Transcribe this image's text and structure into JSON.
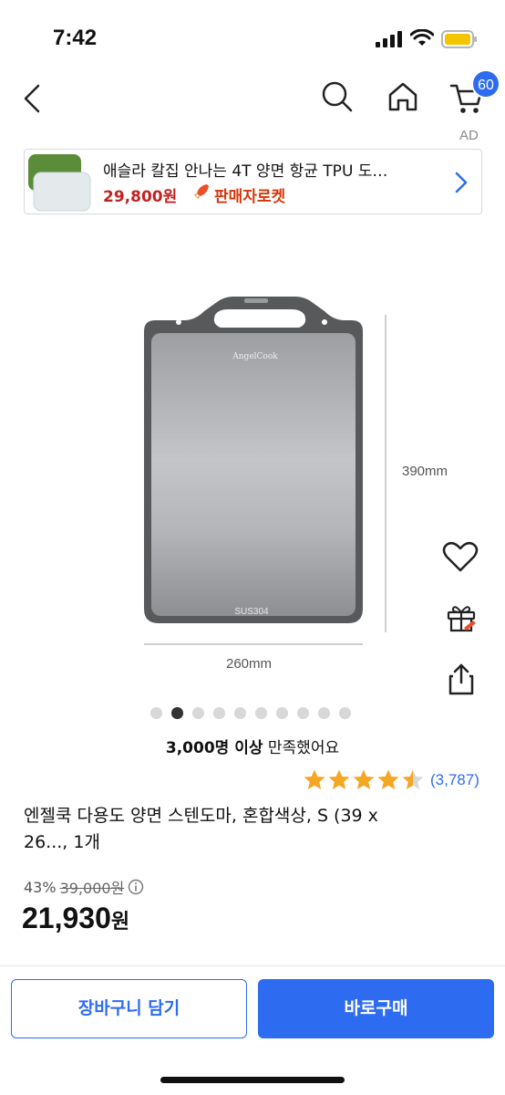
{
  "status_bar": {
    "time": "7:42"
  },
  "header": {
    "cart_count": "60"
  },
  "ad": {
    "label": "AD",
    "title": "애슬라 칼집 안나는 4T 양면 항균 TPU 도…",
    "price": "29,800원",
    "delivery": "판매자로켓"
  },
  "product_image": {
    "engraving": "SUS304",
    "height_label": "390mm",
    "width_label": "260mm"
  },
  "carousel": {
    "total": 10,
    "active_index": 1
  },
  "satisfaction": {
    "bold": "3,000명 이상",
    "rest": "만족했어요"
  },
  "rating": {
    "stars": 4.5,
    "count": "(3,787)"
  },
  "product": {
    "name_line1": "엔젤쿡 다용도 양면 스텐도마, 혼합색상, S (39 x",
    "name_line2": "26..., 1개"
  },
  "pricing": {
    "discount": "43%",
    "original": "39,000원",
    "sale_number": "21,930",
    "sale_unit": "원"
  },
  "buttons": {
    "cart": "장바구니 담기",
    "buy": "바로구매"
  },
  "colors": {
    "accent": "#2d6cf0",
    "price_red": "#c3221f",
    "star": "#f5a623"
  }
}
